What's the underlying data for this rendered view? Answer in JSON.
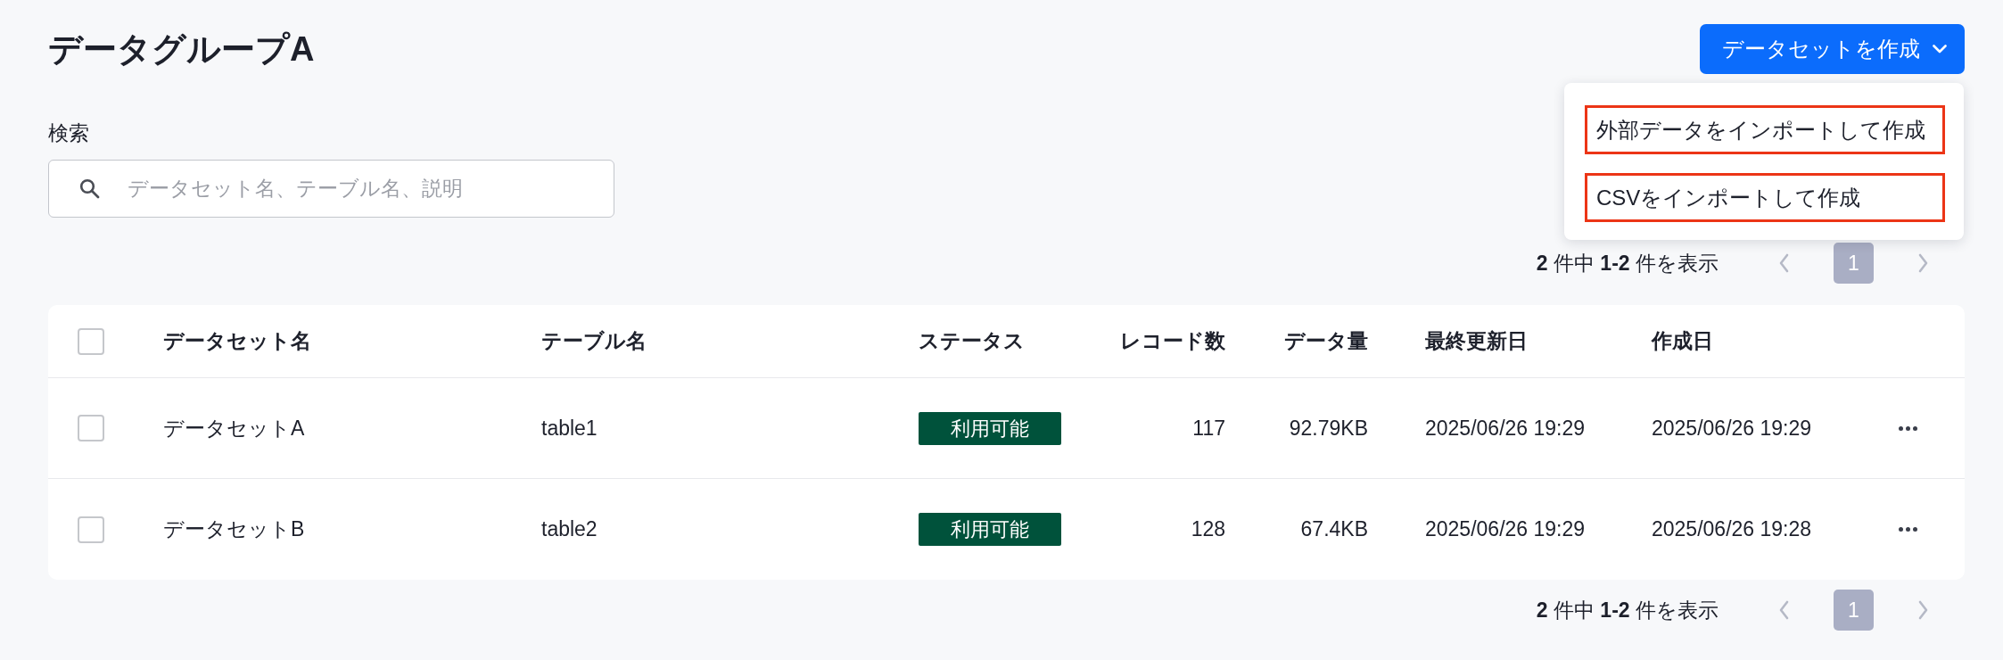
{
  "header": {
    "title": "データグループA",
    "create_button": {
      "label": "データセットを作成",
      "expanded": true,
      "menu": [
        {
          "label": "外部データをインポートして作成",
          "highlighted": true
        },
        {
          "label": "CSVをインポートして作成",
          "highlighted": true
        }
      ]
    }
  },
  "search": {
    "label": "検索",
    "placeholder": "データセット名、テーブル名、説明"
  },
  "pagination_top": {
    "summary": "**2** 件中 **1-2** 件を表示",
    "previous": {
      "disabled": true
    },
    "pages": [
      {
        "label": "1",
        "selected": true
      }
    ],
    "next": {
      "disabled": true
    }
  },
  "table": {
    "select_all": {
      "checked": false
    },
    "columns": [
      {
        "label": "データセット名",
        "kind": "text"
      },
      {
        "label": "テーブル名",
        "kind": "text"
      },
      {
        "label": "ステータス",
        "kind": "status"
      },
      {
        "label": "レコード数",
        "kind": "number"
      },
      {
        "label": "データ量",
        "kind": "number"
      },
      {
        "label": "最終更新日",
        "kind": "text"
      },
      {
        "label": "作成日",
        "kind": "text"
      }
    ],
    "rows": [
      {
        "checked": false,
        "cells": [
          "データセットA",
          "table1",
          "利用可能",
          "117",
          "92.79KB",
          "2025/06/26 19:29",
          "2025/06/26 19:29"
        ]
      },
      {
        "checked": false,
        "cells": [
          "データセットB",
          "table2",
          "利用可能",
          "128",
          "67.4KB",
          "2025/06/26 19:29",
          "2025/06/26 19:28"
        ]
      }
    ]
  },
  "pagination_bottom": {
    "summary": "**2** 件中 **1-2** 件を表示",
    "previous": {
      "disabled": true
    },
    "pages": [
      {
        "label": "1",
        "selected": true
      }
    ],
    "next": {
      "disabled": true
    }
  }
}
